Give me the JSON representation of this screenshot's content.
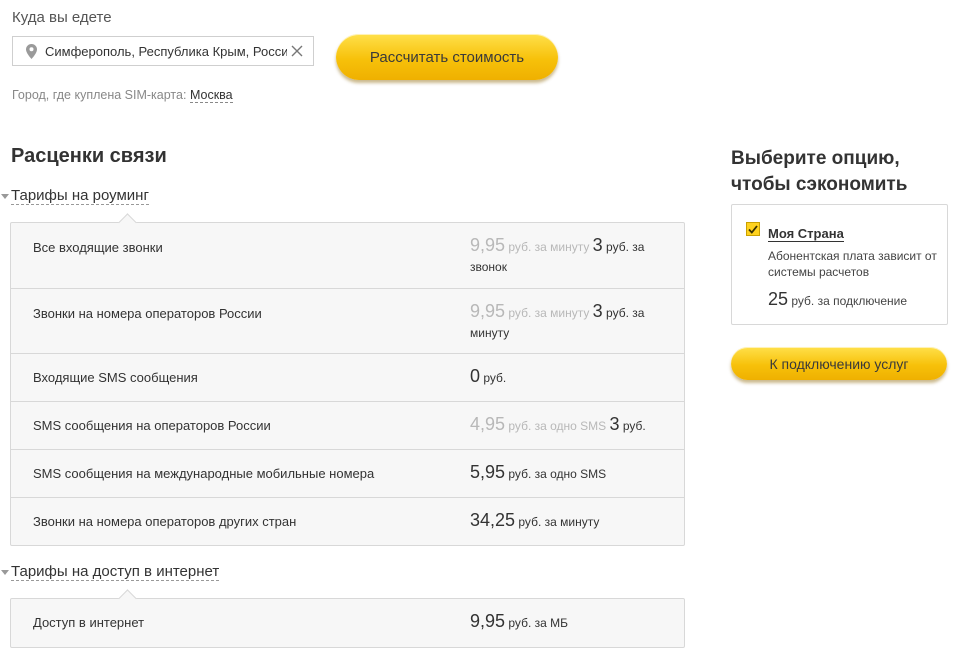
{
  "search": {
    "label": "Куда вы едете",
    "value": "Симферополь, Республика Крым, Россия",
    "calc_button": "Рассчитать стоимость",
    "sim_prefix": "Город, где куплена SIM-карта:",
    "sim_city": "Москва"
  },
  "rates": {
    "title": "Расценки связи",
    "roaming_tab": "Тарифы на роуминг",
    "roaming_rows": [
      {
        "name": "Все входящие звонки",
        "old_value": "9,95",
        "old_unit": "руб. за минуту",
        "value": "3",
        "unit": "руб. за звонок"
      },
      {
        "name": "Звонки на номера операторов России",
        "old_value": "9,95",
        "old_unit": "руб. за минуту",
        "value": "3",
        "unit": "руб. за минуту"
      },
      {
        "name": "Входящие SMS сообщения",
        "value": "0",
        "unit": "руб."
      },
      {
        "name": "SMS сообщения на операторов России",
        "old_value": "4,95",
        "old_unit": "руб. за одно SMS",
        "value": "3",
        "unit": "руб."
      },
      {
        "name": "SMS сообщения на международные мобильные номера",
        "value": "5,95",
        "unit": "руб. за одно SMS"
      },
      {
        "name": "Звонки на номера операторов других стран",
        "value": "34,25",
        "unit": "руб. за минуту"
      }
    ],
    "internet_tab": "Тарифы на доступ в интернет",
    "internet_rows": [
      {
        "name": "Доступ в интернет",
        "value": "9,95",
        "unit": "руб. за МБ"
      }
    ]
  },
  "option": {
    "title": "Выберите опцию, чтобы сэкономить",
    "name": "Моя Страна",
    "checked": true,
    "desc": "Абонентская плата зависит от системы расчетов",
    "price_value": "25",
    "price_unit": "руб. за подключение",
    "connect_button": "К подключению услуг"
  },
  "colors": {
    "accent": "#f7c10a",
    "muted": "#b8b8b8"
  }
}
